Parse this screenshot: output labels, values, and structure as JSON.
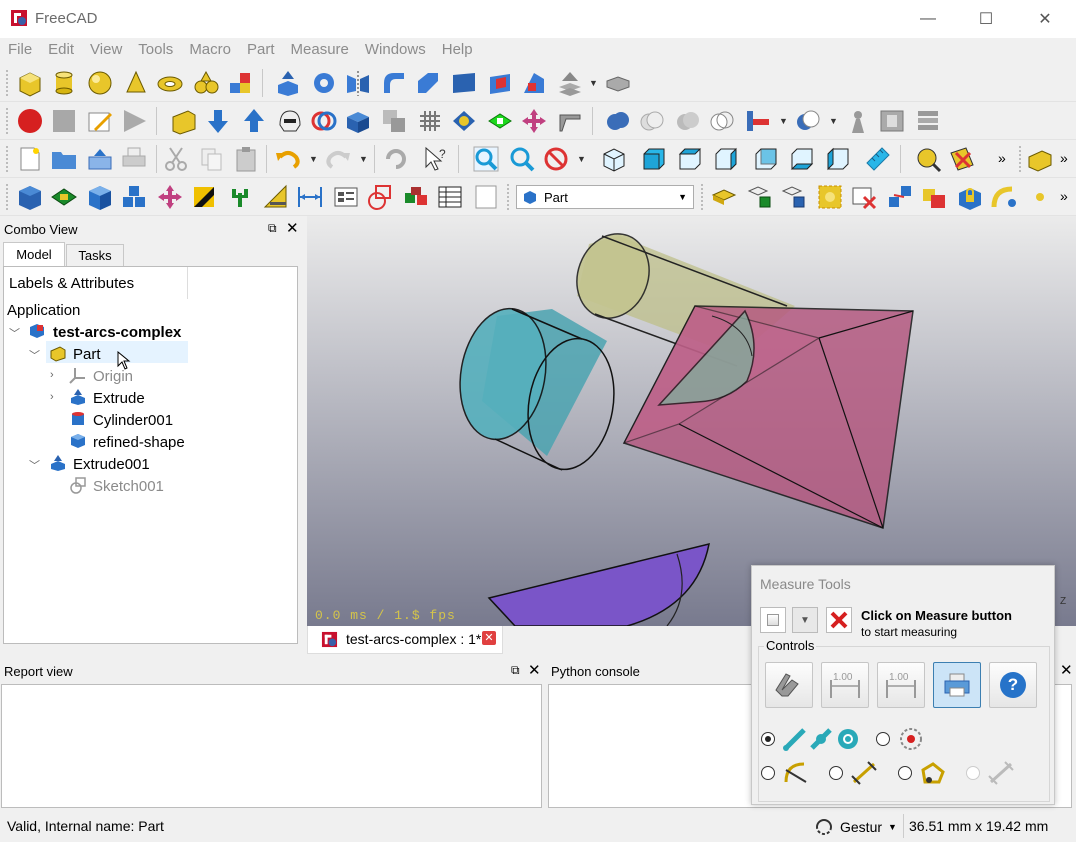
{
  "window": {
    "title": "FreeCAD",
    "minimize": "—",
    "maximize": "☐",
    "close": "✕"
  },
  "menu": [
    "File",
    "Edit",
    "View",
    "Tools",
    "Macro",
    "Part",
    "Measure",
    "Windows",
    "Help"
  ],
  "workbench_selector": {
    "value": "Part"
  },
  "combo_view": {
    "title": "Combo View",
    "tabs": [
      "Model",
      "Tasks"
    ],
    "active_tab": "Model",
    "tree_header": "Labels & Attributes",
    "section": "Application",
    "items": [
      {
        "label": "test-arcs-complex",
        "bold": true
      },
      {
        "label": "Part"
      },
      {
        "label": "Origin",
        "dim": true
      },
      {
        "label": "Extrude"
      },
      {
        "label": "Cylinder001"
      },
      {
        "label": "refined-shape"
      },
      {
        "label": "Extrude001"
      },
      {
        "label": "Sketch001",
        "dim": true
      }
    ]
  },
  "viewport": {
    "fps": "0.0 ms / 1.$ fps",
    "axis_label": "Z"
  },
  "doc_tab": {
    "label": "test-arcs-complex : 1*"
  },
  "report_view": {
    "title": "Report view"
  },
  "python_console": {
    "title": "Python console"
  },
  "measure_tools": {
    "title": "Measure Tools",
    "instruction_bold": "Click on Measure button",
    "instruction": "to start measuring",
    "controls_label": "Controls",
    "ruler_value_1": "1.00",
    "ruler_value_2": "1.00",
    "help": "?"
  },
  "status": {
    "message": "Valid, Internal name: Part",
    "nav_style": "Gestur",
    "dimensions": "36.51 mm x 19.42 mm"
  },
  "colors": {
    "cylinder": "#4ba3b0",
    "cylinder2": "#bdbf8a",
    "box": "#b5577f",
    "bowl": "#7a55c8",
    "accent": "#2673c9"
  }
}
